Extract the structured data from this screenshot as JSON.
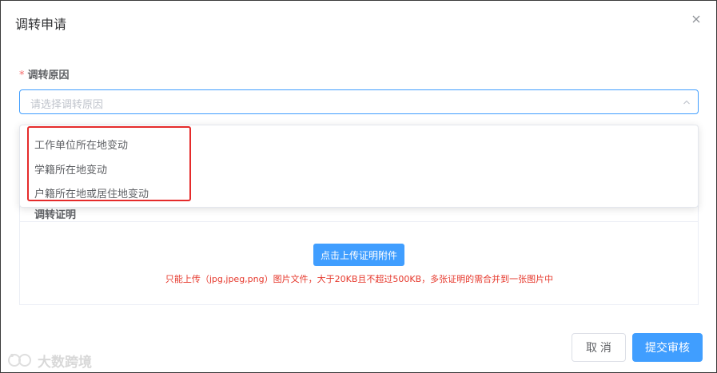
{
  "dialog": {
    "title": "调转申请",
    "close_icon": "close-icon"
  },
  "form": {
    "reason_label": "调转原因",
    "required_mark": "*",
    "reason_placeholder": "请选择调转原因"
  },
  "dropdown": {
    "options": [
      "工作单位所在地变动",
      "学籍所在地变动",
      "户籍所在地或居住地变动"
    ]
  },
  "proof_section": {
    "title": "调转证明",
    "upload_button": "点击上传证明附件",
    "hint": "只能上传（jpg,jpeg,png）图片文件，大于20KB且不超过500KB，多张证明的需合并到一张图片中"
  },
  "footer": {
    "cancel_label": "取 消",
    "submit_label": "提交审核"
  },
  "watermark": {
    "text": "大数跨境"
  },
  "colors": {
    "primary": "#409eff",
    "danger": "#e6382c",
    "highlight_box": "#e52b2b"
  }
}
